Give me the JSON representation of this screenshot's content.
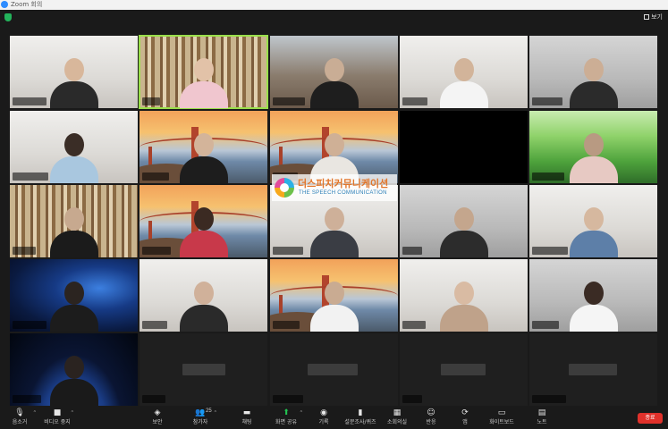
{
  "window": {
    "title": "Zoom 회의"
  },
  "topbar": {
    "view_label": "보기"
  },
  "watermark": {
    "korean": "더스피치커뮤니케이션",
    "english": "THE SPEECH COMMUNICATION"
  },
  "toolbar": {
    "mute_label": "음소거",
    "video_label": "비디오 중지",
    "security_label": "보안",
    "participants_label": "참가자",
    "participants_count": "25",
    "chat_label": "채팅",
    "share_label": "화면 공유",
    "record_label": "기록",
    "polls_label": "설문조사/퀴즈",
    "breakout_label": "소회의실",
    "reactions_label": "반응",
    "apps_label": "앱",
    "whiteboard_label": "화이트보드",
    "notes_label": "노트",
    "end_label": "종료"
  },
  "colors": {
    "active_speaker": "#9adf4b",
    "end_button": "#e0312b",
    "share_icon": "#23c552",
    "bg": "#1a1a1a"
  }
}
